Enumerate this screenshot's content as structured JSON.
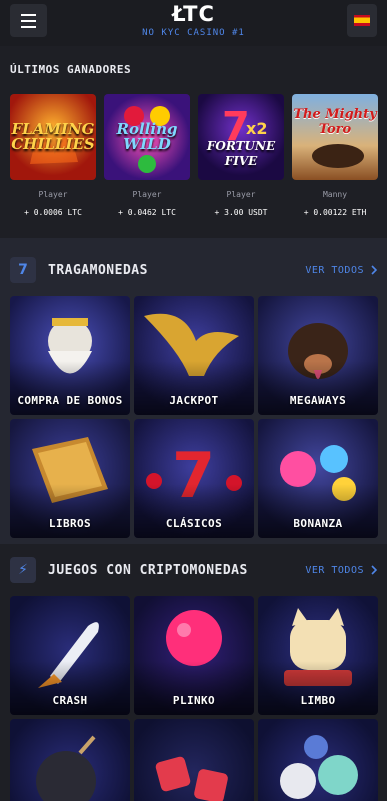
{
  "header": {
    "logo": "ŁTC",
    "tagline": "NO KYC CASINO #1",
    "menu_icon": "hamburger-icon",
    "language_icon": "spain-flag-icon"
  },
  "winners": {
    "title": "ÚLTIMOS GANADORES",
    "items": [
      {
        "game": "FLAMING CHILLIES",
        "player": "Player",
        "amount": "+ 0.0006 LTC"
      },
      {
        "game": "Rolling WILD",
        "player": "Player",
        "amount": "+ 0.0462 LTC"
      },
      {
        "game": "FORTUNE FIVE",
        "player": "Player",
        "amount": "+ 3.00 USDT"
      },
      {
        "game": "The Mighty Toro",
        "player": "Manny",
        "amount": "+ 0.00122 ETH"
      }
    ]
  },
  "slots": {
    "icon_text": "7",
    "title": "TRAGAMONEDAS",
    "see_all": "VER TODOS",
    "tiles": [
      "COMPRA DE BONOS",
      "JACKPOT",
      "MEGAWAYS",
      "LIBROS",
      "CLÁSICOS",
      "BONANZA"
    ]
  },
  "crypto": {
    "icon_text": "⚡",
    "title": "JUEGOS CON CRIPTOMONEDAS",
    "see_all": "VER TODOS",
    "tiles": [
      "CRASH",
      "PLINKO",
      "LIMBO",
      "",
      "",
      ""
    ]
  },
  "colors": {
    "accent": "#4f86e8",
    "background": "#1e1f25",
    "band": "#252731"
  }
}
